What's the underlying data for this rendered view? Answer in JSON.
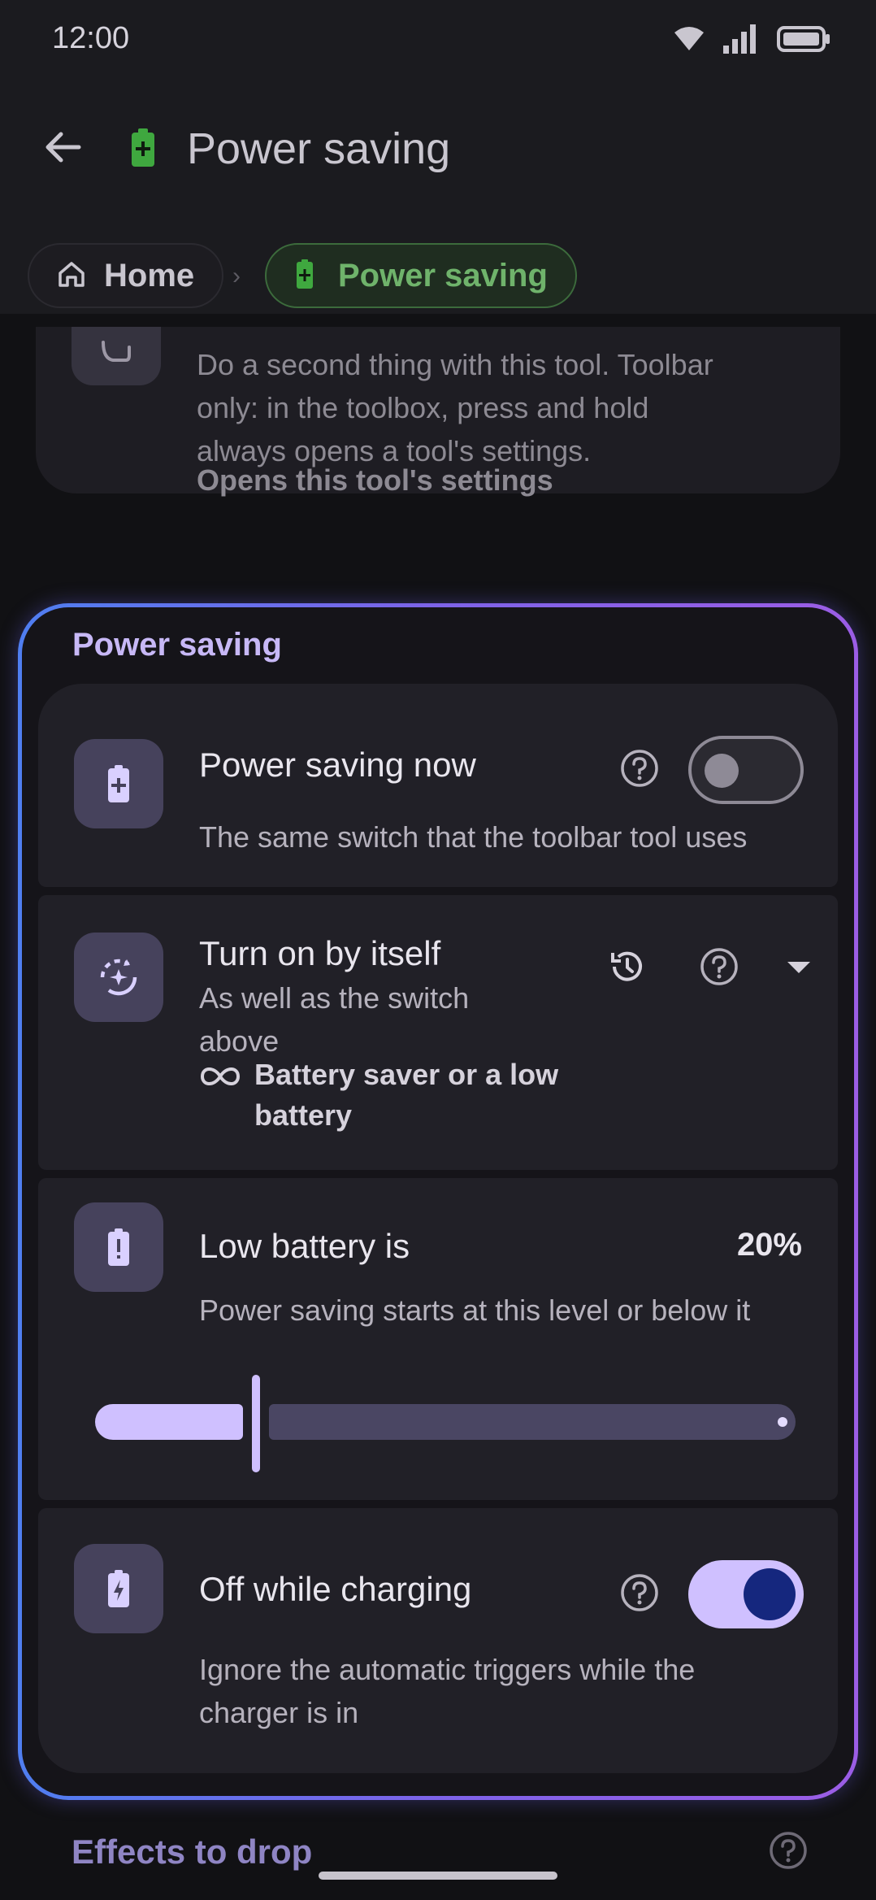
{
  "status_bar": {
    "time": "12:00",
    "icons": [
      "wifi-icon",
      "signal-icon",
      "battery-icon"
    ]
  },
  "app_bar": {
    "title": "Power saving",
    "back_icon": "arrow-left-icon",
    "title_icon": "battery-plus-icon"
  },
  "breadcrumb": {
    "home_label": "Home",
    "current_label": "Power saving",
    "separator": "›"
  },
  "previous_card": {
    "text": "Do a second thing with this tool. Toolbar only: in the toolbox, press and hold always opens a tool's settings.",
    "bold_text": "Opens this tool's settings"
  },
  "group": {
    "title": "Power saving",
    "items": [
      {
        "title": "Power saving now",
        "description": "The same switch that the toolbar tool uses",
        "switch_on": false,
        "icon": "battery-plus-icon"
      },
      {
        "title": "Turn on by itself",
        "description": "As well as the switch above",
        "detail": "Battery saver or a low battery",
        "detail_icon": "infinity-icon",
        "icon": "auto-mode-icon"
      },
      {
        "title": "Low battery is",
        "value": "20%",
        "description": "Power saving starts at this level or below it",
        "slider_fraction": 0.2,
        "icon": "battery-alert-icon"
      },
      {
        "title": "Off while charging",
        "description": "Ignore the automatic triggers while the charger is in",
        "switch_on": true,
        "icon": "battery-charging-icon"
      }
    ]
  },
  "section_next": {
    "title": "Effects to drop"
  },
  "colors": {
    "accent": "#cfc0ff",
    "switch_thumb_on": "#15277e",
    "breadcrumb_active": "#6fb36b",
    "group_border_start": "#4f7ef0",
    "group_border_end": "#9b5de5"
  }
}
